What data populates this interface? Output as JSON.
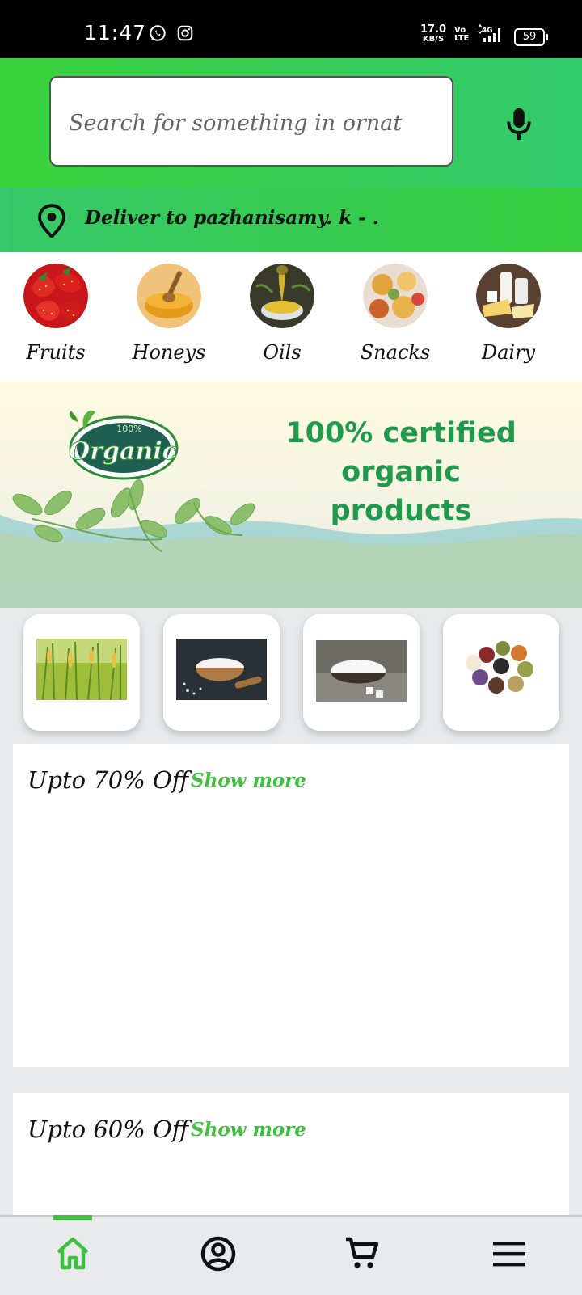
{
  "status_bar": {
    "time": "11:47",
    "net_speed_value": "17.0",
    "net_speed_unit": "KB/S",
    "volte_top": "Vo",
    "volte_bottom": "LTE",
    "network": "4G",
    "battery": "59"
  },
  "search": {
    "placeholder": "Search for something in ornat"
  },
  "delivery": {
    "text": "Deliver to pazhanisamy. k - ."
  },
  "categories": [
    {
      "label": "Fruits",
      "icon": "strawberries"
    },
    {
      "label": "Honeys",
      "icon": "honey-bowl"
    },
    {
      "label": "Oils",
      "icon": "oil-bowl"
    },
    {
      "label": "Snacks",
      "icon": "snack-bowls"
    },
    {
      "label": "Dairy",
      "icon": "dairy-products"
    }
  ],
  "banner": {
    "badge_top": "100%",
    "badge_word": "Organic",
    "headline_line1": "100% certified",
    "headline_line2": "organic products"
  },
  "products": [
    {
      "name": "rice-crop"
    },
    {
      "name": "salt"
    },
    {
      "name": "sugar"
    },
    {
      "name": "pulses"
    }
  ],
  "sections": [
    {
      "title": "Upto 70% Off",
      "more": "Show more"
    },
    {
      "title": "Upto 60% Off",
      "more": "Show more"
    }
  ],
  "bottom_nav": [
    {
      "name": "home",
      "active": true
    },
    {
      "name": "account",
      "active": false
    },
    {
      "name": "cart",
      "active": false
    },
    {
      "name": "menu",
      "active": false
    }
  ],
  "colors": {
    "accent_green": "#3dc03d",
    "headline_green": "#1f9a4d"
  }
}
